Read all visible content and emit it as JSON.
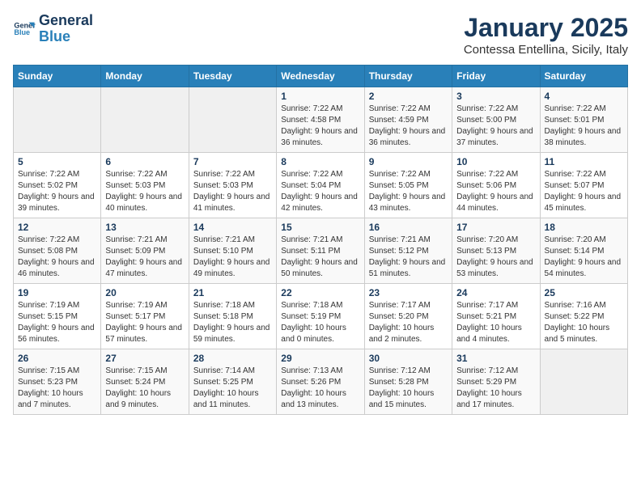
{
  "logo": {
    "line1": "General",
    "line2": "Blue"
  },
  "title": "January 2025",
  "subtitle": "Contessa Entellina, Sicily, Italy",
  "weekdays": [
    "Sunday",
    "Monday",
    "Tuesday",
    "Wednesday",
    "Thursday",
    "Friday",
    "Saturday"
  ],
  "weeks": [
    [
      {
        "day": "",
        "info": ""
      },
      {
        "day": "",
        "info": ""
      },
      {
        "day": "",
        "info": ""
      },
      {
        "day": "1",
        "info": "Sunrise: 7:22 AM\nSunset: 4:58 PM\nDaylight: 9 hours and 36 minutes."
      },
      {
        "day": "2",
        "info": "Sunrise: 7:22 AM\nSunset: 4:59 PM\nDaylight: 9 hours and 36 minutes."
      },
      {
        "day": "3",
        "info": "Sunrise: 7:22 AM\nSunset: 5:00 PM\nDaylight: 9 hours and 37 minutes."
      },
      {
        "day": "4",
        "info": "Sunrise: 7:22 AM\nSunset: 5:01 PM\nDaylight: 9 hours and 38 minutes."
      }
    ],
    [
      {
        "day": "5",
        "info": "Sunrise: 7:22 AM\nSunset: 5:02 PM\nDaylight: 9 hours and 39 minutes."
      },
      {
        "day": "6",
        "info": "Sunrise: 7:22 AM\nSunset: 5:03 PM\nDaylight: 9 hours and 40 minutes."
      },
      {
        "day": "7",
        "info": "Sunrise: 7:22 AM\nSunset: 5:03 PM\nDaylight: 9 hours and 41 minutes."
      },
      {
        "day": "8",
        "info": "Sunrise: 7:22 AM\nSunset: 5:04 PM\nDaylight: 9 hours and 42 minutes."
      },
      {
        "day": "9",
        "info": "Sunrise: 7:22 AM\nSunset: 5:05 PM\nDaylight: 9 hours and 43 minutes."
      },
      {
        "day": "10",
        "info": "Sunrise: 7:22 AM\nSunset: 5:06 PM\nDaylight: 9 hours and 44 minutes."
      },
      {
        "day": "11",
        "info": "Sunrise: 7:22 AM\nSunset: 5:07 PM\nDaylight: 9 hours and 45 minutes."
      }
    ],
    [
      {
        "day": "12",
        "info": "Sunrise: 7:22 AM\nSunset: 5:08 PM\nDaylight: 9 hours and 46 minutes."
      },
      {
        "day": "13",
        "info": "Sunrise: 7:21 AM\nSunset: 5:09 PM\nDaylight: 9 hours and 47 minutes."
      },
      {
        "day": "14",
        "info": "Sunrise: 7:21 AM\nSunset: 5:10 PM\nDaylight: 9 hours and 49 minutes."
      },
      {
        "day": "15",
        "info": "Sunrise: 7:21 AM\nSunset: 5:11 PM\nDaylight: 9 hours and 50 minutes."
      },
      {
        "day": "16",
        "info": "Sunrise: 7:21 AM\nSunset: 5:12 PM\nDaylight: 9 hours and 51 minutes."
      },
      {
        "day": "17",
        "info": "Sunrise: 7:20 AM\nSunset: 5:13 PM\nDaylight: 9 hours and 53 minutes."
      },
      {
        "day": "18",
        "info": "Sunrise: 7:20 AM\nSunset: 5:14 PM\nDaylight: 9 hours and 54 minutes."
      }
    ],
    [
      {
        "day": "19",
        "info": "Sunrise: 7:19 AM\nSunset: 5:15 PM\nDaylight: 9 hours and 56 minutes."
      },
      {
        "day": "20",
        "info": "Sunrise: 7:19 AM\nSunset: 5:17 PM\nDaylight: 9 hours and 57 minutes."
      },
      {
        "day": "21",
        "info": "Sunrise: 7:18 AM\nSunset: 5:18 PM\nDaylight: 9 hours and 59 minutes."
      },
      {
        "day": "22",
        "info": "Sunrise: 7:18 AM\nSunset: 5:19 PM\nDaylight: 10 hours and 0 minutes."
      },
      {
        "day": "23",
        "info": "Sunrise: 7:17 AM\nSunset: 5:20 PM\nDaylight: 10 hours and 2 minutes."
      },
      {
        "day": "24",
        "info": "Sunrise: 7:17 AM\nSunset: 5:21 PM\nDaylight: 10 hours and 4 minutes."
      },
      {
        "day": "25",
        "info": "Sunrise: 7:16 AM\nSunset: 5:22 PM\nDaylight: 10 hours and 5 minutes."
      }
    ],
    [
      {
        "day": "26",
        "info": "Sunrise: 7:15 AM\nSunset: 5:23 PM\nDaylight: 10 hours and 7 minutes."
      },
      {
        "day": "27",
        "info": "Sunrise: 7:15 AM\nSunset: 5:24 PM\nDaylight: 10 hours and 9 minutes."
      },
      {
        "day": "28",
        "info": "Sunrise: 7:14 AM\nSunset: 5:25 PM\nDaylight: 10 hours and 11 minutes."
      },
      {
        "day": "29",
        "info": "Sunrise: 7:13 AM\nSunset: 5:26 PM\nDaylight: 10 hours and 13 minutes."
      },
      {
        "day": "30",
        "info": "Sunrise: 7:12 AM\nSunset: 5:28 PM\nDaylight: 10 hours and 15 minutes."
      },
      {
        "day": "31",
        "info": "Sunrise: 7:12 AM\nSunset: 5:29 PM\nDaylight: 10 hours and 17 minutes."
      },
      {
        "day": "",
        "info": ""
      }
    ]
  ]
}
